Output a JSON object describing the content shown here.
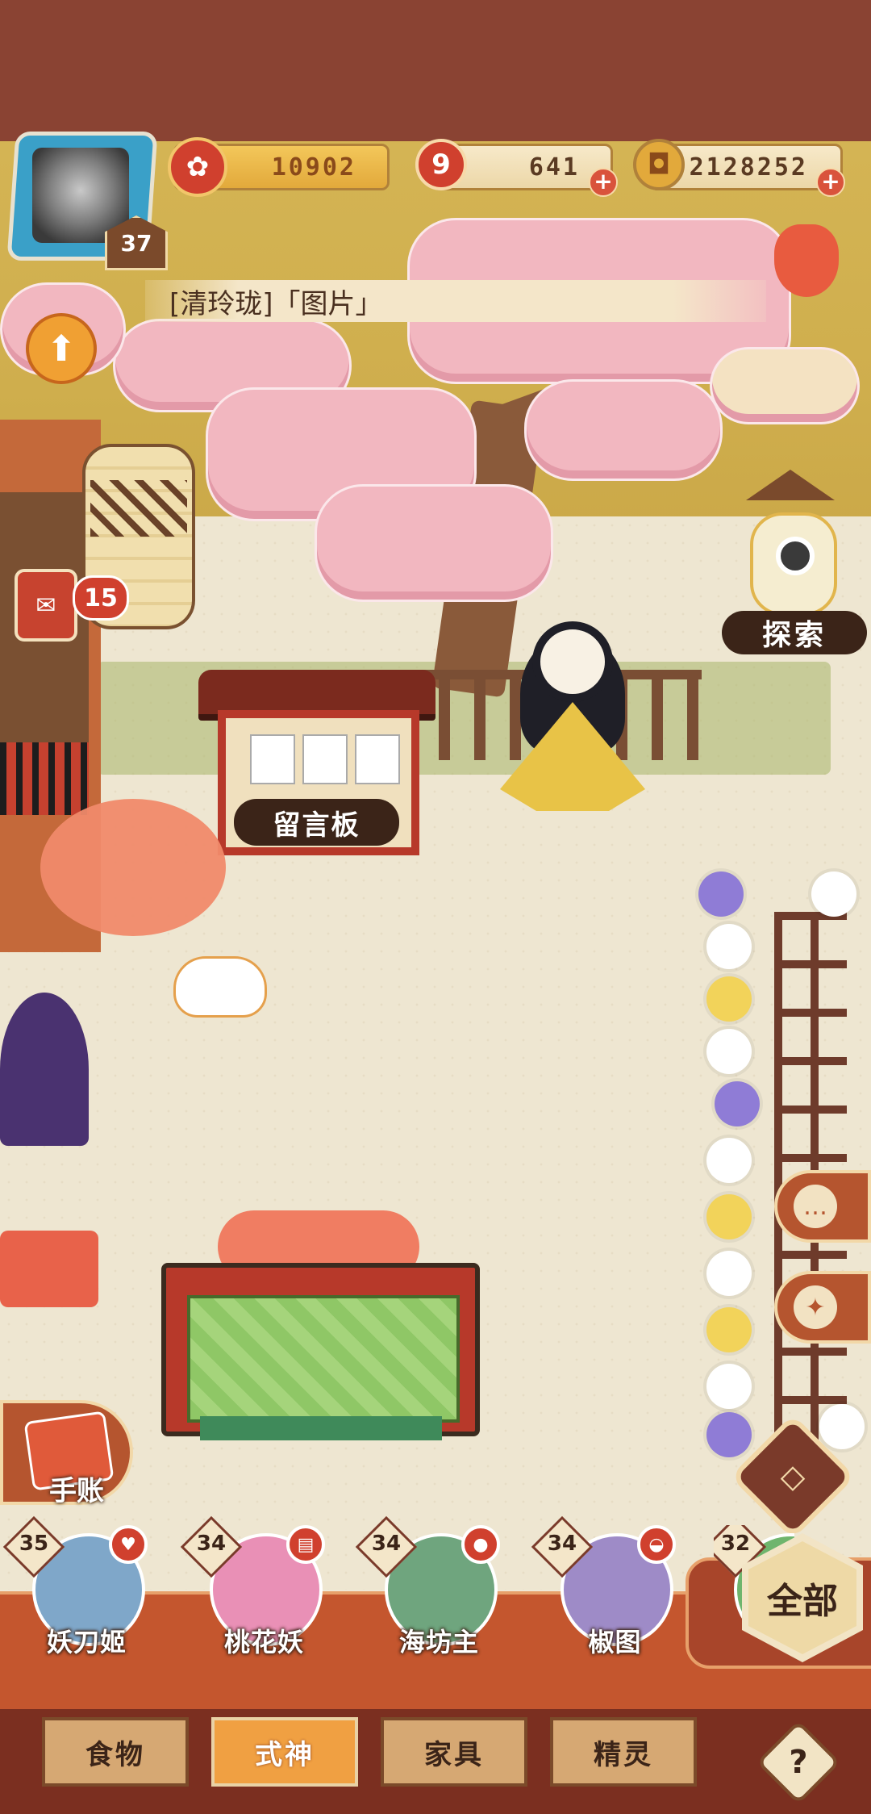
{
  "currencies": {
    "stamina": "10902",
    "magatama": "641",
    "gold": "2128252"
  },
  "player": {
    "level": "37",
    "name": "[清玲珑]「图片」"
  },
  "scene": {
    "notice_board_label": "留言板",
    "explore_label": "探索",
    "notification_count": "15",
    "notebook_label": "手账"
  },
  "shikigami": [
    {
      "level": "35",
      "name": "妖刀姬",
      "color": "#7fa7c9"
    },
    {
      "level": "34",
      "name": "桃花妖",
      "color": "#e990b6"
    },
    {
      "level": "34",
      "name": "海坊主",
      "color": "#6fa57e"
    },
    {
      "level": "34",
      "name": "椒图",
      "color": "#9e8bc7"
    },
    {
      "level": "32",
      "name": "",
      "color": "#6fb56d"
    }
  ],
  "all_button": "全部",
  "tabs": [
    {
      "label": "食物",
      "active": false
    },
    {
      "label": "式神",
      "active": true
    },
    {
      "label": "家具",
      "active": false
    },
    {
      "label": "精灵",
      "active": false
    }
  ],
  "help": "?",
  "colors": {
    "accent": "#c4562e",
    "active_tab": "#f0a042",
    "badge_red": "#d0402e"
  }
}
